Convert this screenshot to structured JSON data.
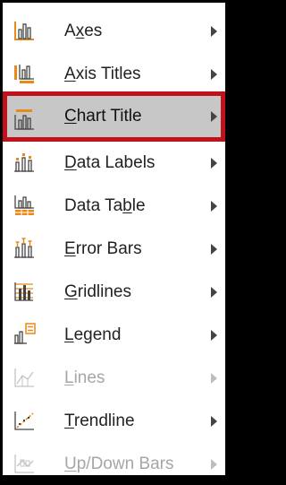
{
  "menu": {
    "items": [
      {
        "id": "axes",
        "before": "A",
        "u": "x",
        "after": "es",
        "disabled": false,
        "selected": false,
        "icon": "axes-icon"
      },
      {
        "id": "axis-titles",
        "before": "",
        "u": "A",
        "after": "xis Titles",
        "disabled": false,
        "selected": false,
        "icon": "axis-titles-icon"
      },
      {
        "id": "chart-title",
        "before": "",
        "u": "C",
        "after": "hart Title",
        "disabled": false,
        "selected": true,
        "icon": "chart-title-icon"
      },
      {
        "id": "data-labels",
        "before": "",
        "u": "D",
        "after": "ata Labels",
        "disabled": false,
        "selected": false,
        "icon": "data-labels-icon"
      },
      {
        "id": "data-table",
        "before": "Data Ta",
        "u": "b",
        "after": "le",
        "disabled": false,
        "selected": false,
        "icon": "data-table-icon"
      },
      {
        "id": "error-bars",
        "before": "",
        "u": "E",
        "after": "rror Bars",
        "disabled": false,
        "selected": false,
        "icon": "error-bars-icon"
      },
      {
        "id": "gridlines",
        "before": "",
        "u": "G",
        "after": "ridlines",
        "disabled": false,
        "selected": false,
        "icon": "gridlines-icon"
      },
      {
        "id": "legend",
        "before": "",
        "u": "L",
        "after": "egend",
        "disabled": false,
        "selected": false,
        "icon": "legend-icon"
      },
      {
        "id": "lines",
        "before": "",
        "u": "L",
        "after": "ines",
        "disabled": true,
        "selected": false,
        "icon": "lines-icon"
      },
      {
        "id": "trendline",
        "before": "",
        "u": "T",
        "after": "rendline",
        "disabled": false,
        "selected": false,
        "icon": "trendline-icon"
      },
      {
        "id": "up-down-bars",
        "before": "",
        "u": "U",
        "after": "p/Down Bars",
        "disabled": true,
        "selected": false,
        "icon": "up-down-bars-icon"
      }
    ]
  },
  "colors": {
    "accent": "#e8891a",
    "highlight": "#c7c7c7",
    "selection_border": "#c0121a",
    "disabled": "#a6a6a6"
  }
}
